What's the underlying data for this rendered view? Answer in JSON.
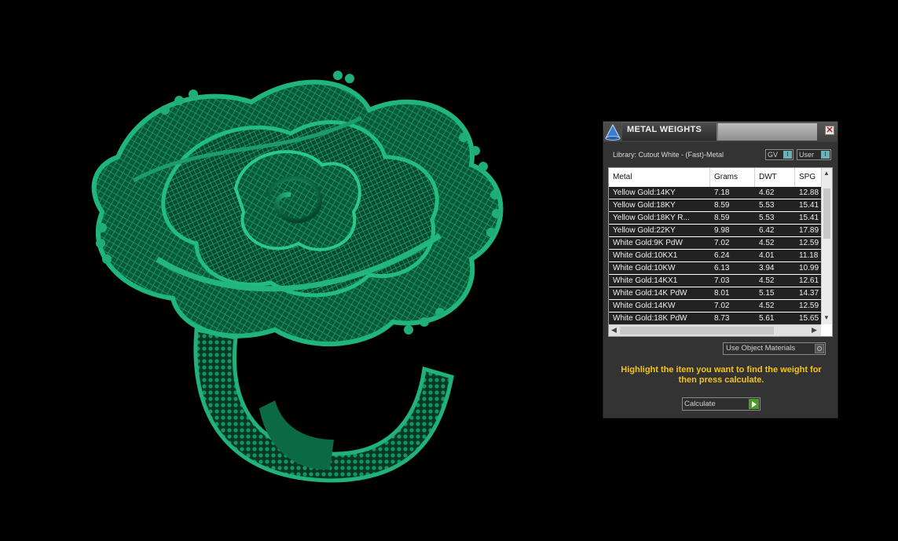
{
  "panel": {
    "title": "METAL WEIGHTS",
    "close_glyph": "✕",
    "library_label": "Library: Cutout White - (Fast)-Metal",
    "toggles": [
      {
        "label": "GV",
        "state": "I"
      },
      {
        "label": "User",
        "state": "I"
      }
    ],
    "table": {
      "headers": [
        "Metal",
        "Grams",
        "DWT",
        "SPG"
      ],
      "rows": [
        [
          "Yellow Gold:14KY",
          "7.18",
          "4.62",
          "12.88"
        ],
        [
          "Yellow Gold:18KY",
          "8.59",
          "5.53",
          "15.41"
        ],
        [
          "Yellow Gold:18KY R...",
          "8.59",
          "5.53",
          "15.41"
        ],
        [
          "Yellow Gold:22KY",
          "9.98",
          "6.42",
          "17.89"
        ],
        [
          "White Gold:9K PdW",
          "7.02",
          "4.52",
          "12.59"
        ],
        [
          "White Gold:10KX1",
          "6.24",
          "4.01",
          "11.18"
        ],
        [
          "White Gold:10KW",
          "6.13",
          "3.94",
          "10.99"
        ],
        [
          "White Gold:14KX1",
          "7.03",
          "4.52",
          "12.61"
        ],
        [
          "White Gold:14K PdW",
          "8.01",
          "5.15",
          "14.37"
        ],
        [
          "White Gold:14KW",
          "7.02",
          "4.52",
          "12.59"
        ],
        [
          "White Gold:18K PdW",
          "8.73",
          "5.61",
          "15.65"
        ]
      ]
    },
    "use_object_materials": "Use Object Materials",
    "instruction": "Highlight the item you want to find the weight for then press calculate.",
    "calculate_label": "Calculate"
  },
  "colors": {
    "ring": "#0e7a4f",
    "accent_text": "#f2c418",
    "background": "#000000"
  },
  "icons": {
    "logo": "cone-logo-icon",
    "close": "close-icon",
    "calculate": "play-icon"
  }
}
